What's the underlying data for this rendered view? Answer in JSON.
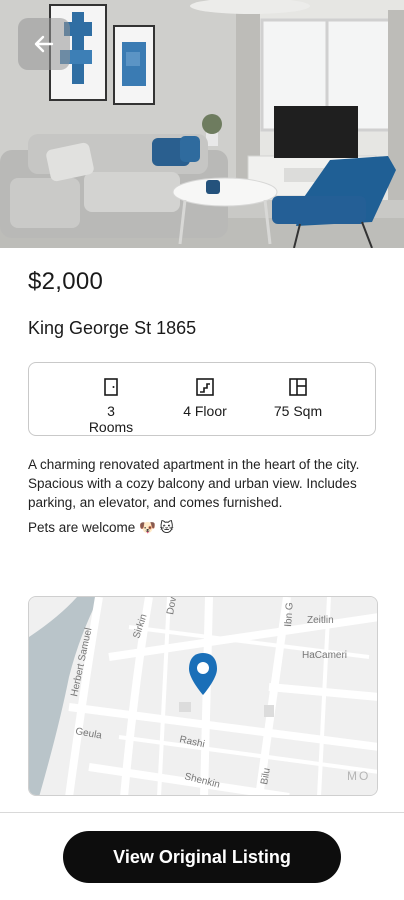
{
  "listing": {
    "price": "$2,000",
    "address": "King George St 1865"
  },
  "features": [
    {
      "icon": "door-icon",
      "label": "3 Rooms"
    },
    {
      "icon": "stairs-icon",
      "label": "4 Floor"
    },
    {
      "icon": "floorplan-icon",
      "label": "75 Sqm"
    }
  ],
  "description": {
    "text1": "A charming renovated apartment in the heart of the city.",
    "text2": "Spacious with a cozy balcony and urban view. Includes parking, an elevator, and comes furnished.",
    "pets": "Pets are welcome 🐶 🐱"
  },
  "map": {
    "labels": [
      "Herbert Samuel",
      "Sirkin",
      "Dov",
      "Ibn G",
      "Zeitlin",
      "HaCameri",
      "Geula",
      "Rashi",
      "Shenkin",
      "Bilu",
      "MO"
    ],
    "pin_color": "#1a6fb8"
  },
  "actions": {
    "view_original": "View Original Listing"
  }
}
